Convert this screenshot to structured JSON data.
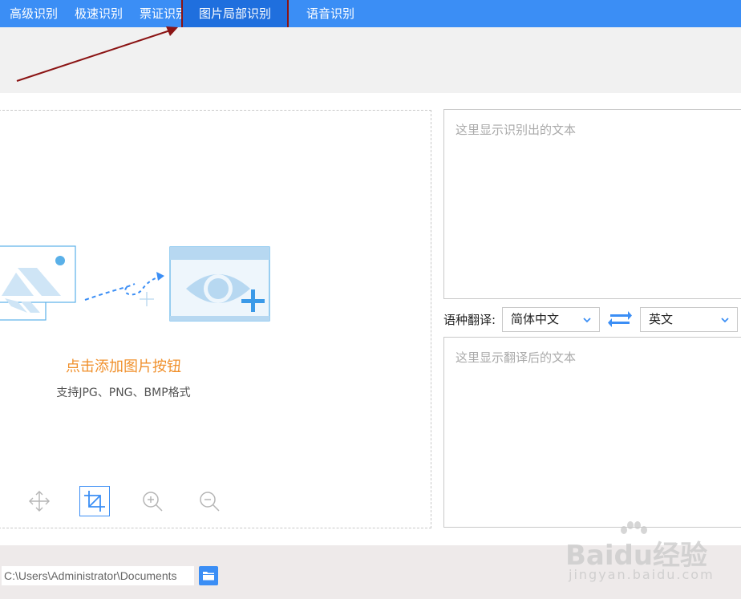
{
  "tabs": [
    {
      "label": "高级识别",
      "active": false
    },
    {
      "label": "极速识别",
      "active": false
    },
    {
      "label": "票证识别",
      "active": false
    },
    {
      "label": "图片局部识别",
      "active": true
    },
    {
      "label": "语音识别",
      "active": false
    }
  ],
  "image_panel": {
    "add_label": "点击添加图片按钮",
    "support_label": "支持JPG、PNG、BMP格式",
    "tools": [
      "move-icon",
      "crop-icon",
      "zoom-in-icon",
      "zoom-out-icon"
    ],
    "active_tool": "crop-icon"
  },
  "result": {
    "placeholder": "这里显示识别出的文本"
  },
  "translation": {
    "label": "语种翻译:",
    "source_lang": "简体中文",
    "target_lang": "英文",
    "placeholder": "这里显示翻译后的文本"
  },
  "footer": {
    "path": "C:\\Users\\Administrator\\Documents"
  },
  "watermark": {
    "main": "Baidu经验",
    "sub": "jingyan.baidu.com"
  },
  "colors": {
    "tabbar": "#3b8ef5",
    "tab_active": "#1f6fde",
    "accent_orange": "#f0902c",
    "highlight": "#8b1414"
  }
}
